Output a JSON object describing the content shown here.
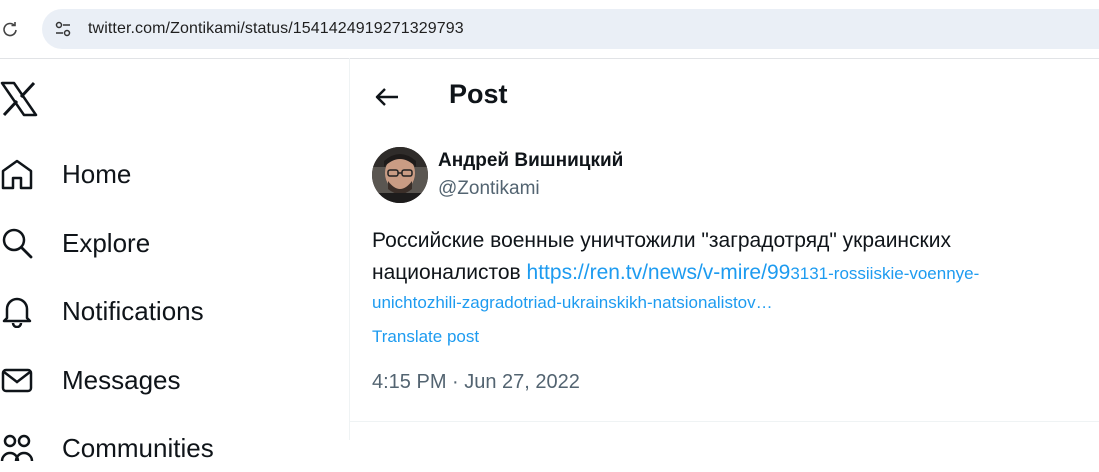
{
  "browser": {
    "url": "twitter.com/Zontikami/status/1541424919271329793",
    "reload_icon": "reload-icon",
    "site_info_icon": "tune-icon"
  },
  "sidebar": {
    "logo_icon": "x-logo-icon",
    "items": [
      {
        "label": "Home",
        "icon": "home-icon"
      },
      {
        "label": "Explore",
        "icon": "search-icon"
      },
      {
        "label": "Notifications",
        "icon": "bell-icon"
      },
      {
        "label": "Messages",
        "icon": "mail-icon"
      },
      {
        "label": "Communities",
        "icon": "people-icon"
      }
    ]
  },
  "header": {
    "back_icon": "arrow-left-icon",
    "title": "Post"
  },
  "post": {
    "author_name": "Андрей Вишницкий",
    "author_handle": "@Zontikami",
    "text": "Российские военные уничтожили \"заградотряд\" украинских националистов",
    "link_part1": "https://ren.tv/news/v-mire/99",
    "link_part2": "3131-rossiiskie-voennye-",
    "link_part3": "unichtozhili-zagradotriad-ukrainskikh-natsionalistov…",
    "translate_label": "Translate post",
    "timestamp": "4:15 PM · Jun 27, 2022"
  },
  "colors": {
    "accent": "#1d9bf0",
    "text_primary": "#0f1419",
    "text_secondary": "#536471",
    "omnibox_bg": "#eaeff6"
  }
}
